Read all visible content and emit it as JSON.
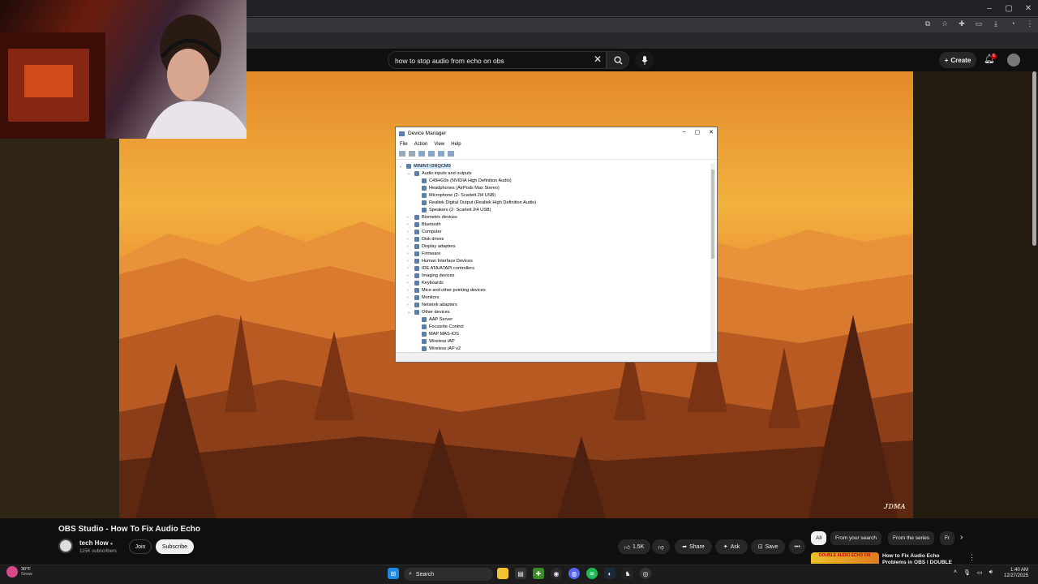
{
  "browser": {
    "window_controls": [
      "–",
      "▢",
      "✕"
    ],
    "toolbar_icons": [
      "cast-icon",
      "star-icon",
      "extensions-icon",
      "sidebar-icon",
      "download-icon",
      "profile-icon",
      "menu-icon"
    ]
  },
  "youtube_header": {
    "search_query": "how to stop audio from echo on obs",
    "create_label": "Create",
    "notification_count": "6"
  },
  "device_manager": {
    "title": "Device Manager",
    "menu": [
      "File",
      "Action",
      "View",
      "Help"
    ],
    "tree": {
      "root": "MININT-I2RQCM9",
      "audio_group": "Audio inputs and outputs",
      "audio_children": [
        "C49HG9x (NVIDIA High Definition Audio)",
        "Headphones (AirPods Max Stereo)",
        "Microphone (2- Scarlett 2i4 USB)",
        "Realtek Digital Output (Realtek High Definition Audio)",
        "Speakers (2- Scarlett 2i4 USB)"
      ],
      "categories": [
        "Biometric devices",
        "Bluetooth",
        "Computer",
        "Disk drives",
        "Display adapters",
        "Firmware",
        "Human Interface Devices",
        "IDE ATA/ATAPI controllers",
        "Imaging devices",
        "Keyboards",
        "Mice and other pointing devices",
        "Monitors",
        "Network adapters"
      ],
      "other_group": "Other devices",
      "other_children": [
        "AAP Server",
        "Focusrite Control",
        "MAP MAS-iOS",
        "Wireless iAP",
        "Wireless iAP v2"
      ]
    }
  },
  "video": {
    "watermark": "ᴊᴅᴍᴀ",
    "title": "OBS Studio - How To Fix Audio Echo"
  },
  "channel": {
    "name": "tech How",
    "subscribers": "115K subscribers",
    "join_label": "Join",
    "subscribe_label": "Subscribe"
  },
  "actions": {
    "likes": "1.5K",
    "share": "Share",
    "ask": "Ask",
    "save": "Save"
  },
  "chips": [
    "All",
    "From your search",
    "From the series",
    "Fr"
  ],
  "recommendation": {
    "thumb_text": "DOUBLE AUDIO ECHO FIX",
    "title": "How to Fix Audio Echo Problems in OBS | DOUBLE"
  },
  "taskbar": {
    "weather_temp": "30°F",
    "weather_desc": "Snow",
    "search_label": "Search",
    "time": "1:40 AM",
    "date": "12/27/2025"
  }
}
